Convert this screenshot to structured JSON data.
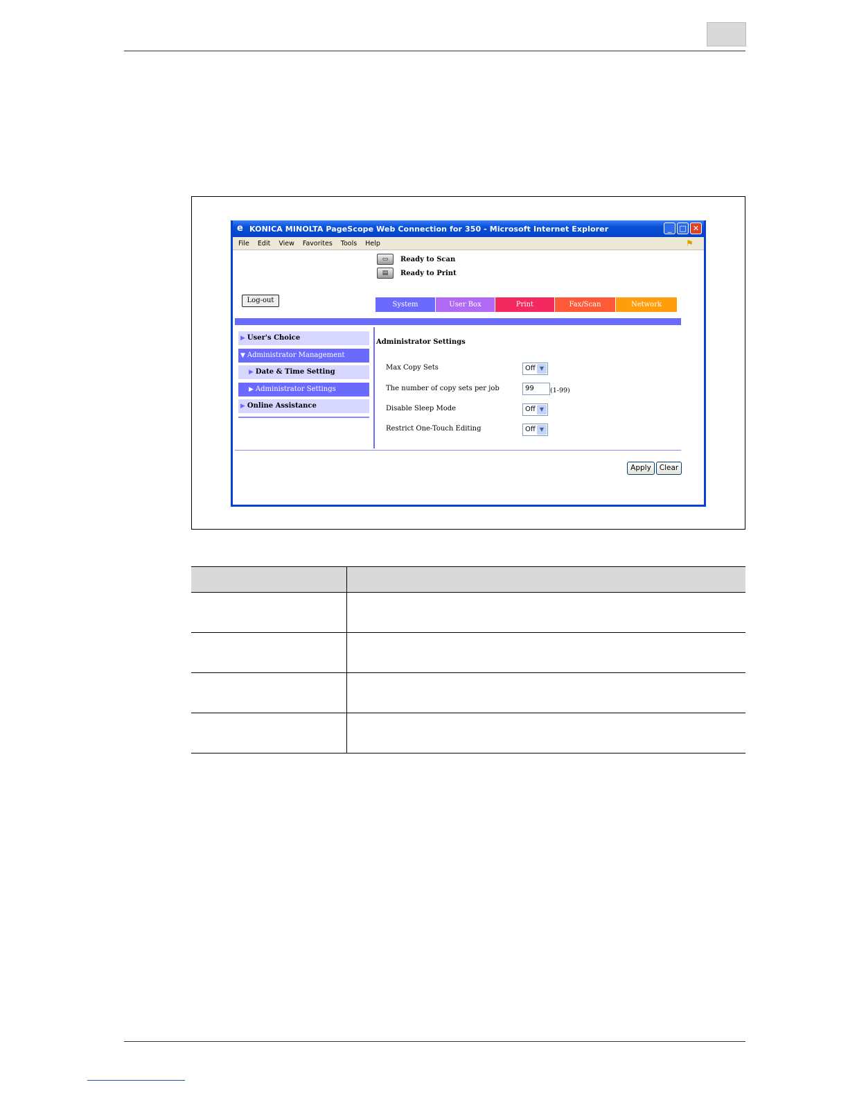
{
  "window": {
    "title": "KONICA MINOLTA PageScope Web Connection for 350 - Microsoft Internet Explorer",
    "menu": [
      "File",
      "Edit",
      "View",
      "Favorites",
      "Tools",
      "Help"
    ]
  },
  "status": {
    "scan": "Ready to Scan",
    "print": "Ready to Print"
  },
  "logout_label": "Log-out",
  "tabs": [
    "System",
    "User Box",
    "Print",
    "Fax/Scan",
    "Network"
  ],
  "nav": {
    "users_choice": "User's Choice",
    "admin_management": "Administrator Management",
    "date_time": "Date & Time Setting",
    "admin_settings": "Administrator Settings",
    "online_assistance": "Online Assistance"
  },
  "content": {
    "title": "Administrator Settings",
    "max_copy_sets": {
      "label": "Max Copy Sets",
      "value": "Off"
    },
    "copy_sets_per_job": {
      "label": "The number of copy sets per job",
      "value": "99",
      "range": "(1-99)"
    },
    "disable_sleep": {
      "label": "Disable Sleep Mode",
      "value": "Off"
    },
    "restrict_one_touch": {
      "label": "Restrict One-Touch Editing",
      "value": "Off"
    }
  },
  "buttons": {
    "apply": "Apply",
    "clear": "Clear"
  },
  "colors": {
    "system_tab": "#6a6aff",
    "userbox_tab": "#b06af5",
    "print_tab": "#f32a60",
    "faxscan_tab": "#ff5a38",
    "network_tab": "#ff9d0a"
  }
}
